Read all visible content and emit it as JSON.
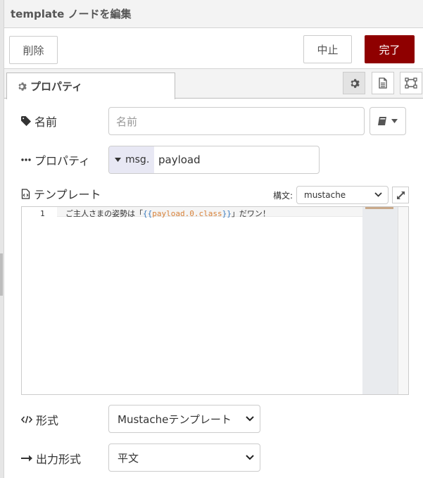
{
  "dialog": {
    "title": "template ノードを編集"
  },
  "toolbar": {
    "delete_label": "削除",
    "cancel_label": "中止",
    "done_label": "完了"
  },
  "tabs": {
    "properties_label": "プロパティ"
  },
  "form": {
    "name_label": "名前",
    "name_placeholder": "名前",
    "property_label": "プロパティ",
    "property_prefix": "msg.",
    "property_value": "payload",
    "template_label": "テンプレート",
    "syntax_label": "構文:",
    "syntax_value": "mustache",
    "format_label": "形式",
    "format_value": "Mustacheテンプレート",
    "output_label": "出力形式",
    "output_value": "平文"
  },
  "editor": {
    "line_number": "1",
    "text_before": "ご主人さまの姿勢は「",
    "brace_open": "{{",
    "expression": "payload.0.class",
    "brace_close": "}}",
    "text_after": "」だワン！"
  },
  "colors": {
    "done_button": "#8f0000",
    "expression": "#d8823a",
    "brace": "#3b7bbf"
  },
  "icons": {
    "properties_tab": "gear-icon",
    "name": "tag-icon",
    "property": "ellipsis-icon",
    "template": "file-code-icon",
    "format": "code-icon",
    "output": "arrow-right-icon",
    "name_library": "book-icon",
    "settings": "gear-icon",
    "description": "file-text-icon",
    "appearance": "node-appearance-icon",
    "expand": "expand-icon"
  }
}
